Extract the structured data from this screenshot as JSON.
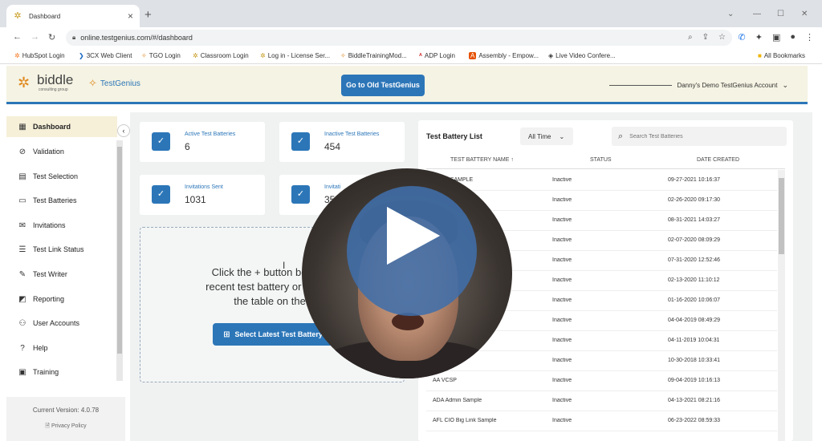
{
  "browser": {
    "tab_title": "Dashboard",
    "url": "online.testgenius.com/#/dashboard",
    "bookmarks": [
      {
        "label": "HubSpot Login",
        "icon": "hubspot-icon"
      },
      {
        "label": "3CX Web Client",
        "icon": "3cx-icon"
      },
      {
        "label": "TGO Login",
        "icon": "testgenius-icon"
      },
      {
        "label": "Classroom Login",
        "icon": "biddle-icon"
      },
      {
        "label": "Log in - License Ser...",
        "icon": "biddle-icon"
      },
      {
        "label": "BiddleTrainingMod...",
        "icon": "testgenius-icon"
      },
      {
        "label": "ADP Login",
        "icon": "adp-icon"
      },
      {
        "label": "Assembly - Empow...",
        "icon": "assembly-icon"
      },
      {
        "label": "Live Video Confere...",
        "icon": "video-icon"
      }
    ],
    "all_bookmarks": "All Bookmarks"
  },
  "header": {
    "biddle_logo": "biddle",
    "biddle_sub": "consulting group",
    "testgenius_logo": "TestGenius",
    "old_button": "Go to Old TestGenius",
    "account": "Danny's Demo TestGenius Account"
  },
  "sidebar": {
    "items": [
      {
        "label": "Dashboard",
        "icon": "grid-icon"
      },
      {
        "label": "Validation",
        "icon": "check-circle-icon"
      },
      {
        "label": "Test Selection",
        "icon": "test-icon"
      },
      {
        "label": "Test Batteries",
        "icon": "battery-icon"
      },
      {
        "label": "Invitations",
        "icon": "mail-icon"
      },
      {
        "label": "Test Link Status",
        "icon": "list-icon"
      },
      {
        "label": "Test Writer",
        "icon": "edit-icon"
      },
      {
        "label": "Reporting",
        "icon": "chart-icon"
      },
      {
        "label": "User Accounts",
        "icon": "user-icon"
      },
      {
        "label": "Help",
        "icon": "help-icon"
      },
      {
        "label": "Training",
        "icon": "training-icon"
      }
    ],
    "version": "Current Version: 4.0.78",
    "privacy": "Privacy Policy"
  },
  "stats": {
    "active_label": "Active Test Batteries",
    "active_value": "6",
    "inactive_label": "Inactive Test Batteries",
    "inactive_value": "454",
    "invites_sent_label": "Invitations Sent",
    "invites_sent_value": "1031",
    "invites_other_label": "Invitati",
    "invites_other_value": "35"
  },
  "dropzone": {
    "line1": "Click the + button below to",
    "line2": "recent test battery or select a",
    "line3": "the table on the r",
    "button": "Select Latest Test Battery"
  },
  "table": {
    "title": "Test Battery List",
    "filter": "All Time",
    "search_placeholder": "Search Test Batteries",
    "columns": {
      "name": "TEST BATTERY NAME ↑",
      "status": "STATUS",
      "date": "DATE CREATED"
    },
    "rows": [
      {
        "name": "Admin SAMPLE",
        "status": "Inactive",
        "date": "09-27-2021 10:16:37"
      },
      {
        "name": "",
        "status": "Inactive",
        "date": "02-26-2020 09:17:30"
      },
      {
        "name": "inistrative SAMI",
        "status": "Inactive",
        "date": "08-31-2021 14:03:27"
      },
      {
        "name": "",
        "status": "Inactive",
        "date": "02-07-2020 08:09:29"
      },
      {
        "name": "",
        "status": "Inactive",
        "date": "07-31-2020 12:52:46"
      },
      {
        "name": "",
        "status": "Inactive",
        "date": "02-13-2020 11:10:12"
      },
      {
        "name": "",
        "status": "Inactive",
        "date": "01-16-2020 10:06:07"
      },
      {
        "name": "",
        "status": "Inactive",
        "date": "04-04-2019 08:49:29"
      },
      {
        "name": "",
        "status": "Inactive",
        "date": "04-11-2019 10:04:31"
      },
      {
        "name": "",
        "status": "Inactive",
        "date": "10-30-2018 10:33:41"
      },
      {
        "name": "AA VCSP",
        "status": "Inactive",
        "date": "09-04-2019 10:16:13"
      },
      {
        "name": "ADA Admin Sample",
        "status": "Inactive",
        "date": "04-13-2021 08:21:16"
      },
      {
        "name": "AFL CIO Big Link Sample",
        "status": "Inactive",
        "date": "06-23-2022 08:59:33"
      }
    ]
  },
  "colors": {
    "accent": "#2c76b8",
    "header_bg": "#f5f3e3",
    "active_nav": "#f6f0d9",
    "play_overlay": "#406eaa"
  }
}
